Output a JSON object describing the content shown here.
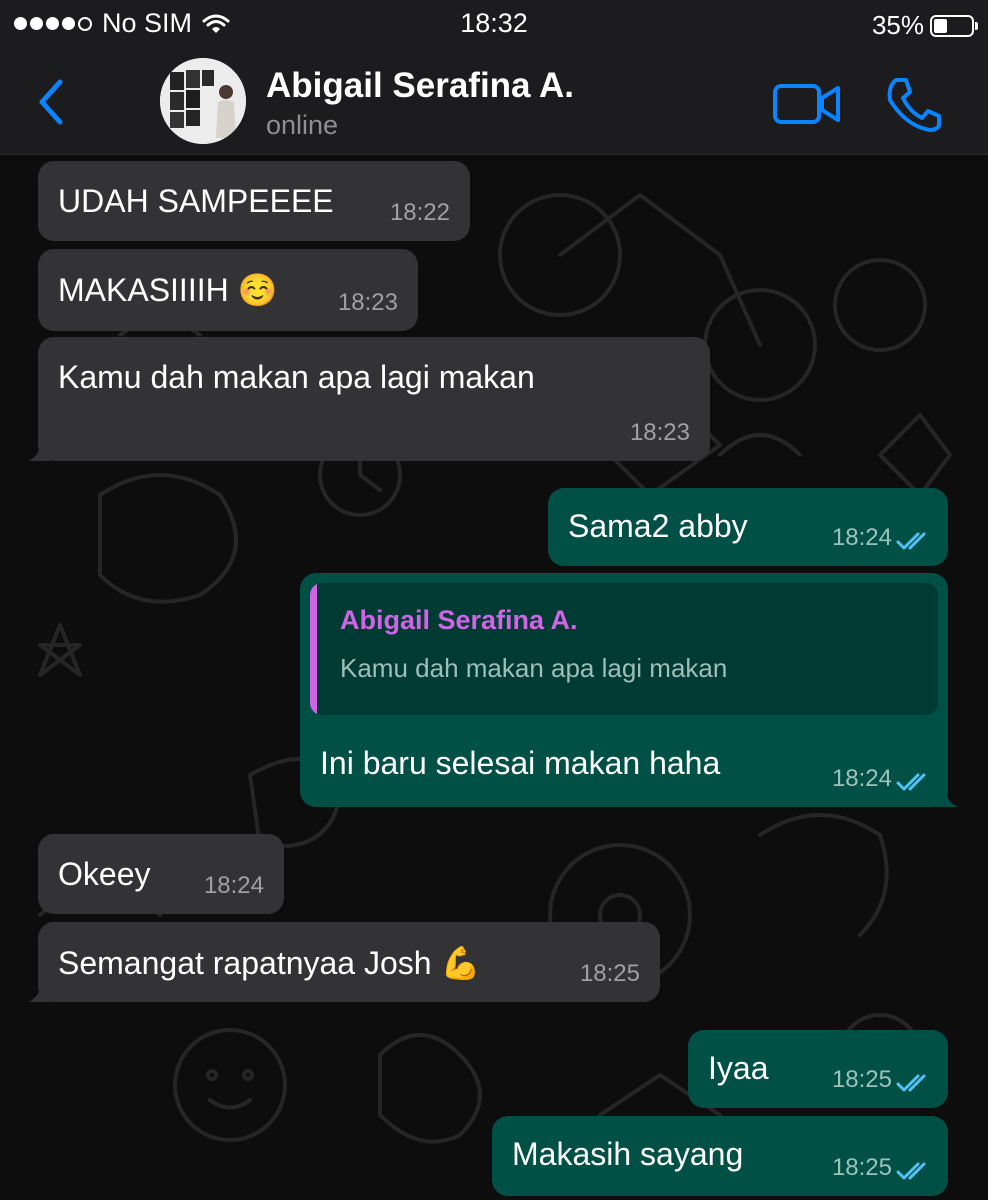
{
  "status_bar": {
    "carrier": "No SIM",
    "time": "18:32",
    "battery": "35%",
    "battery_level": 0.35,
    "signal_bars_filled": 4,
    "signal_bars_total": 5,
    "wifi_icon": "wifi-icon"
  },
  "header": {
    "back_icon": "chevron-left-icon",
    "contact_name": "Abigail Serafina A.",
    "contact_status": "online",
    "video_icon": "video-camera-icon",
    "call_icon": "phone-icon",
    "accent_color": "#0a84ff"
  },
  "messages": [
    {
      "direction": "in",
      "text": "UDAH SAMPEEEE",
      "time": "18:22"
    },
    {
      "direction": "in",
      "text": "MAKASIIIIH ☺️",
      "time": "18:23"
    },
    {
      "direction": "in",
      "text": "Kamu dah makan apa lagi makan",
      "time": "18:23"
    },
    {
      "direction": "out",
      "text": "Sama2 abby",
      "time": "18:24",
      "status": "read"
    },
    {
      "direction": "out",
      "text": "Ini baru selesai makan haha",
      "time": "18:24",
      "status": "read",
      "reply_to": {
        "name": "Abigail Serafina A.",
        "text": "Kamu dah makan apa lagi makan"
      }
    },
    {
      "direction": "in",
      "text": "Okeey",
      "time": "18:24"
    },
    {
      "direction": "in",
      "text": "Semangat rapatnyaa Josh 💪",
      "time": "18:25"
    },
    {
      "direction": "out",
      "text": "Iyaa",
      "time": "18:25",
      "status": "read"
    },
    {
      "direction": "out",
      "text": "Makasih sayang",
      "time": "18:25",
      "status": "read"
    }
  ],
  "colors": {
    "incoming_bubble": "#333335",
    "outgoing_bubble": "#005046",
    "read_ticks": "#4fc3f7",
    "reply_name": "#d064e6"
  }
}
